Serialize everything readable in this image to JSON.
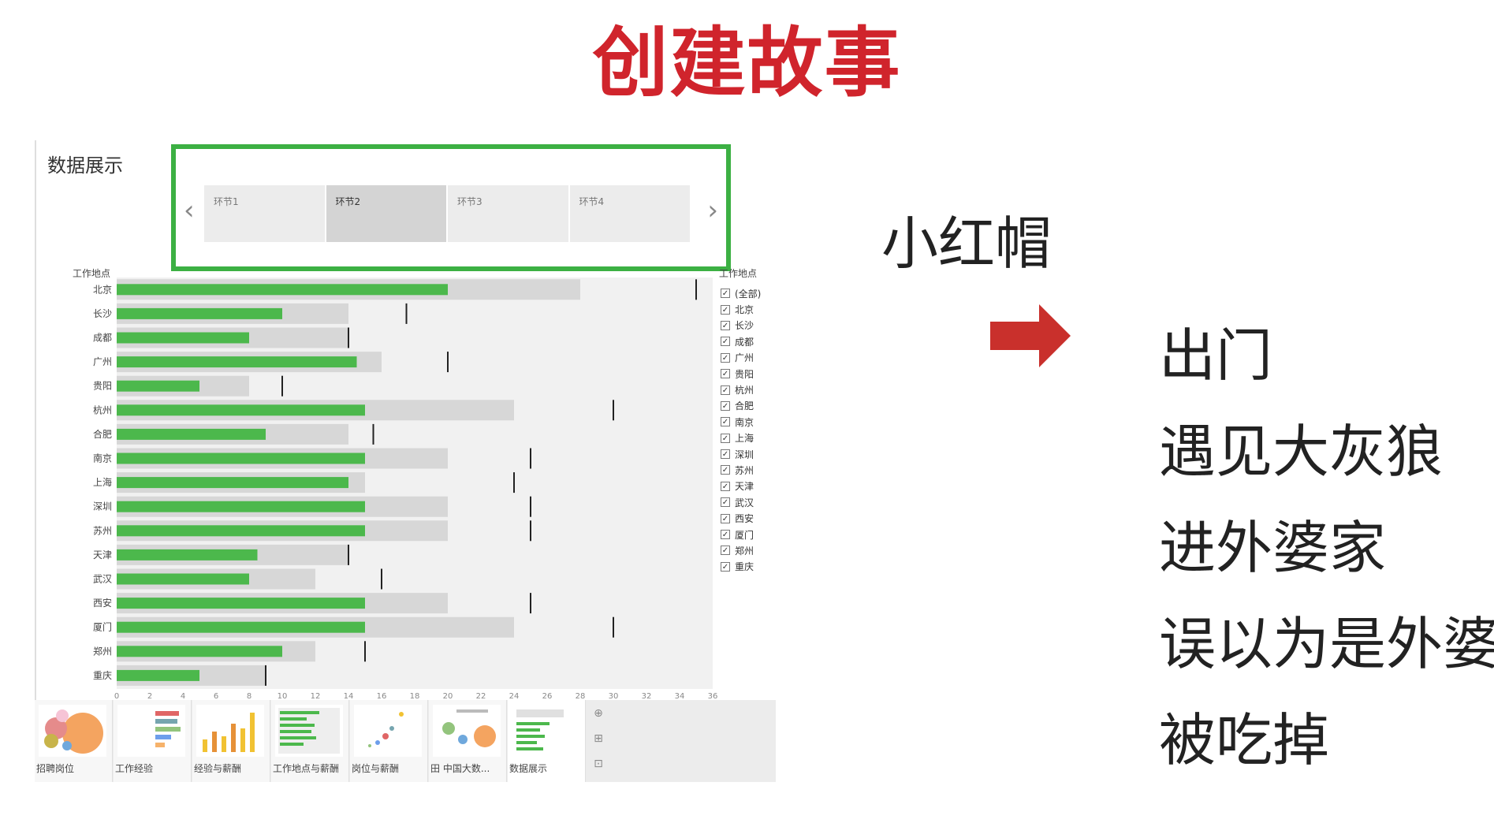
{
  "slide": {
    "title": "创建故事"
  },
  "story": {
    "title": "数据展示",
    "points": [
      {
        "label": "环节1",
        "active": false
      },
      {
        "label": "环节2",
        "active": true
      },
      {
        "label": "环节3",
        "active": false
      },
      {
        "label": "环节4",
        "active": false
      }
    ]
  },
  "chart_data": {
    "type": "bar",
    "ylabel": "工作地点",
    "categories": [
      "北京",
      "长沙",
      "成都",
      "广州",
      "贵阳",
      "杭州",
      "合肥",
      "南京",
      "上海",
      "深圳",
      "苏州",
      "天津",
      "武汉",
      "西安",
      "厦门",
      "郑州",
      "重庆"
    ],
    "values": [
      20,
      10,
      8,
      14.5,
      5,
      15,
      9,
      15,
      14,
      15,
      15,
      8.5,
      8,
      15,
      15,
      10,
      5
    ],
    "band_ends": [
      28,
      14,
      14,
      16,
      8,
      24,
      14,
      20,
      15,
      20,
      20,
      14,
      12,
      20,
      24,
      12,
      9
    ],
    "reference": [
      35,
      17.5,
      14,
      20,
      10,
      30,
      15.5,
      25,
      24,
      25,
      25,
      14,
      16,
      25,
      30,
      15,
      9
    ],
    "xlim": [
      0,
      36
    ],
    "xticks": [
      0,
      2,
      4,
      6,
      8,
      10,
      12,
      14,
      16,
      18,
      20,
      22,
      24,
      26,
      28,
      30,
      32,
      34,
      36
    ],
    "bar_color": "#4cb84c",
    "band_color": "#d7d7d7"
  },
  "legend": {
    "title": "工作地点",
    "items": [
      "(全部)",
      "北京",
      "长沙",
      "成都",
      "广州",
      "贵阳",
      "杭州",
      "合肥",
      "南京",
      "上海",
      "深圳",
      "苏州",
      "天津",
      "武汉",
      "西安",
      "厦门",
      "郑州",
      "重庆"
    ]
  },
  "filmstrip": [
    {
      "label": "招聘岗位"
    },
    {
      "label": "工作经验"
    },
    {
      "label": "经验与薪酬"
    },
    {
      "label": "工作地点与薪酬"
    },
    {
      "label": "岗位与薪酬"
    },
    {
      "label": "田 中国大数..."
    },
    {
      "label": "数据展示",
      "active": true
    }
  ],
  "narrative": {
    "hero": "小红帽",
    "steps": [
      "出门",
      "遇见大灰狼",
      "进外婆家",
      "误以为是外婆",
      "被吃掉"
    ],
    "arrow_color": "#c9302c"
  }
}
